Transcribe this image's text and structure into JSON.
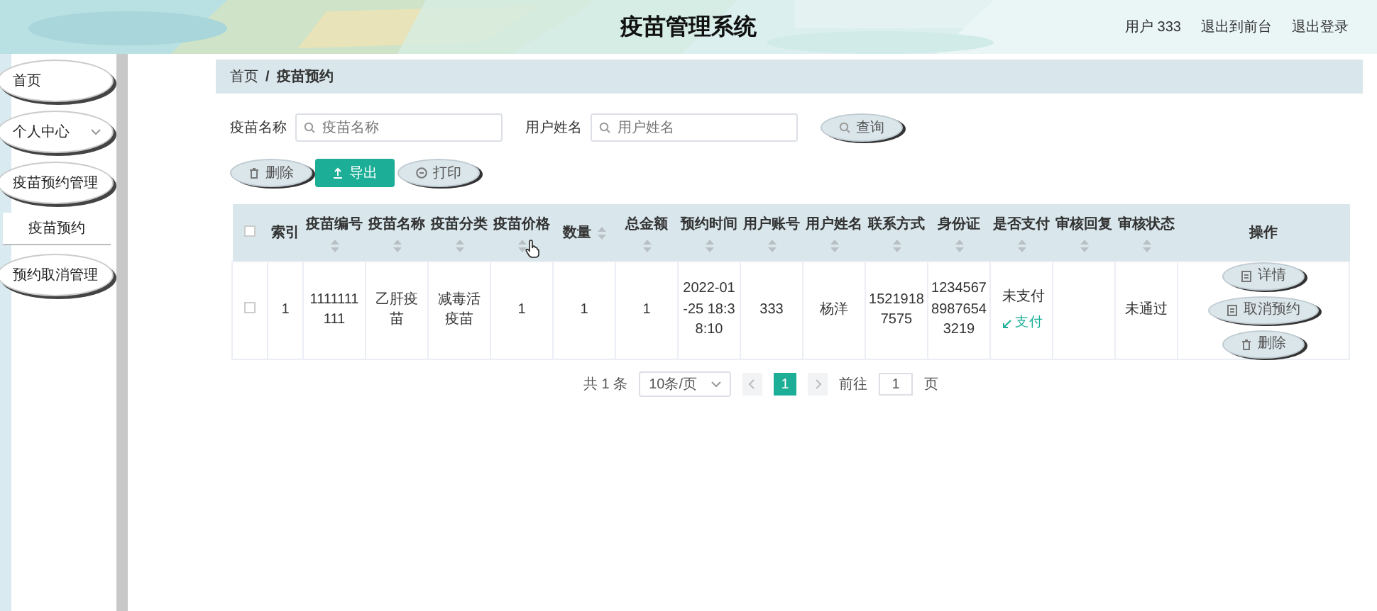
{
  "header": {
    "title": "疫苗管理系统",
    "user": "用户 333",
    "links": [
      "退出到前台",
      "退出登录"
    ]
  },
  "sidebar": {
    "items": [
      {
        "label": "首页",
        "kind": "link"
      },
      {
        "label": "个人中心",
        "kind": "submenu"
      },
      {
        "label": "疫苗预约管理",
        "kind": "submenu",
        "children": [
          {
            "label": "疫苗预约",
            "selected": true
          }
        ]
      },
      {
        "label": "预约取消管理",
        "kind": "submenu"
      }
    ]
  },
  "breadcrumb": {
    "items": [
      "首页",
      "疫苗预约"
    ],
    "separator": "/"
  },
  "search": {
    "fields": [
      {
        "label": "疫苗名称",
        "placeholder": "疫苗名称"
      },
      {
        "label": "用户姓名",
        "placeholder": "用户姓名"
      }
    ],
    "button": "查询"
  },
  "actions": [
    {
      "label": "删除",
      "kind": "delete"
    },
    {
      "label": "导出",
      "kind": "export"
    },
    {
      "label": "打印",
      "kind": "print"
    }
  ],
  "table": {
    "header_checked": false,
    "columns": [
      {
        "label": "索引",
        "sortable": false
      },
      {
        "label": "疫苗编号",
        "sortable": true
      },
      {
        "label": "疫苗名称",
        "sortable": true
      },
      {
        "label": "疫苗分类",
        "sortable": true
      },
      {
        "label": "疫苗价格",
        "sortable": true
      },
      {
        "label": "数量",
        "sortable": true
      },
      {
        "label": "总金额",
        "sortable": true
      },
      {
        "label": "预约时间",
        "sortable": true
      },
      {
        "label": "用户账号",
        "sortable": true
      },
      {
        "label": "用户姓名",
        "sortable": true
      },
      {
        "label": "联系方式",
        "sortable": true
      },
      {
        "label": "身份证",
        "sortable": true
      },
      {
        "label": "是否支付",
        "sortable": true
      },
      {
        "label": "审核回复",
        "sortable": true
      },
      {
        "label": "审核状态",
        "sortable": true
      },
      {
        "label": "操作",
        "sortable": false
      }
    ],
    "rows": [
      {
        "checked": false,
        "index": "1",
        "code": "1111111111",
        "name": "乙肝疫苗",
        "category": "减毒活疫苗",
        "price": "1",
        "quantity": "1",
        "total": "1",
        "time": "2022-01-25 18:38:10",
        "account": "333",
        "username": "杨洋",
        "phone": "15219187575",
        "id_card": "123456789876543219",
        "paid": {
          "status": "未支付",
          "action": "支付"
        },
        "review_status": "未通过",
        "actions": [
          {
            "label": "详情",
            "kind": "detail"
          },
          {
            "label": "取消预约",
            "kind": "cancel"
          },
          {
            "label": "删除",
            "kind": "delete"
          }
        ]
      }
    ]
  },
  "pagination": {
    "total": "共 1 条",
    "page_size": "10条/页",
    "pages": [
      {
        "label": "1",
        "selected": true
      }
    ],
    "goto_label": "前往",
    "goto_value": "1",
    "goto_suffix": "页"
  }
}
